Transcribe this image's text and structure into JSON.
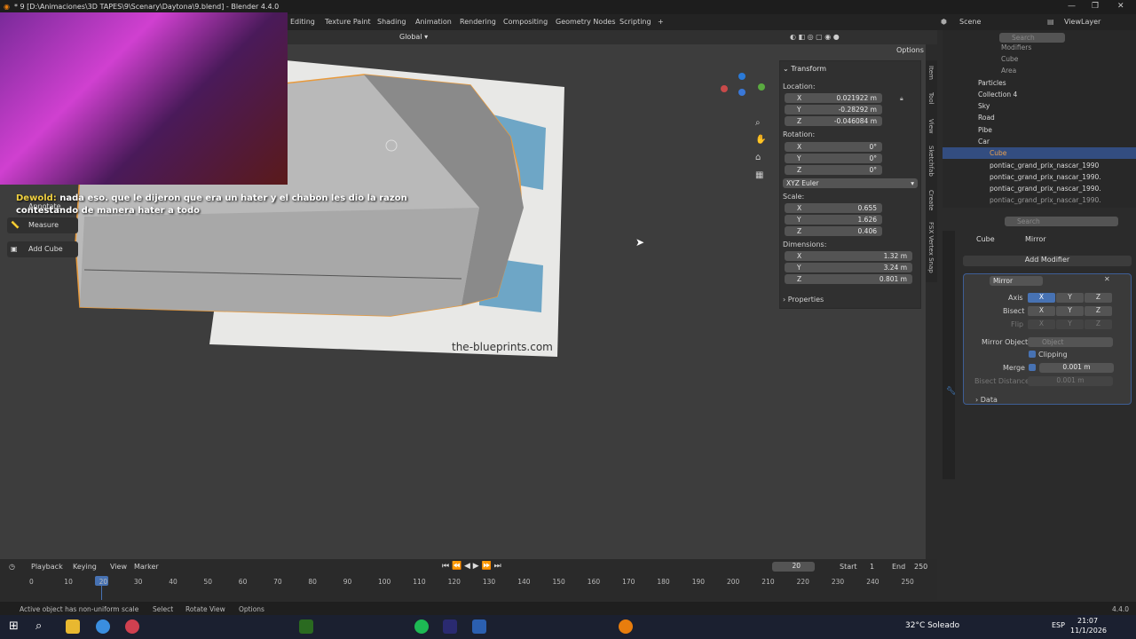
{
  "window": {
    "title": "* 9 [D:\\Animaciones\\3D TAPES\\9\\Scenary\\Daytona\\9.blend] - Blender 4.4.0"
  },
  "menu_tabs": [
    "Editing",
    "Texture Paint",
    "Shading",
    "Animation",
    "Rendering",
    "Compositing",
    "Geometry Nodes",
    "Scripting",
    "+"
  ],
  "top_right": {
    "scene": "Scene",
    "view_layer": "ViewLayer"
  },
  "viewport_header": {
    "orientation": "Global",
    "options": "Options"
  },
  "chat": {
    "user": "Dewold:",
    "line1": " nada eso. que le dijeron que era un hater y el chabon les dio la razon",
    "line2": "contestando de manera hater a todo"
  },
  "tools": {
    "annotate": "Annotate",
    "measure": "Measure",
    "add_cube": "Add Cube"
  },
  "blueprint": {
    "site": "the-blueprints.com"
  },
  "npanel": {
    "section": "Transform",
    "location_label": "Location:",
    "location": [
      {
        "axis": "X",
        "value": "0.021922 m"
      },
      {
        "axis": "Y",
        "value": "-0.28292 m"
      },
      {
        "axis": "Z",
        "value": "-0.046084 m"
      }
    ],
    "rotation_label": "Rotation:",
    "rotation": [
      {
        "axis": "X",
        "value": "0°"
      },
      {
        "axis": "Y",
        "value": "0°"
      },
      {
        "axis": "Z",
        "value": "0°"
      }
    ],
    "rotation_mode": "XYZ Euler",
    "scale_label": "Scale:",
    "scale": [
      {
        "axis": "X",
        "value": "0.655"
      },
      {
        "axis": "Y",
        "value": "1.626"
      },
      {
        "axis": "Z",
        "value": "0.406"
      }
    ],
    "dimensions_label": "Dimensions:",
    "dimensions": [
      {
        "axis": "X",
        "value": "1.32 m"
      },
      {
        "axis": "Y",
        "value": "3.24 m"
      },
      {
        "axis": "Z",
        "value": "0.801 m"
      }
    ],
    "properties": "Properties"
  },
  "side_tabs": [
    "Item",
    "Tool",
    "View",
    "Sketchfab",
    "Create",
    "FSX Vertex Snap"
  ],
  "outliner": {
    "search_placeholder": "Search",
    "rows": [
      "Modifiers",
      "Cube",
      "Area",
      "Particles",
      "Collection 4",
      "Sky",
      "Road",
      "Pibe",
      "Car",
      "Cube",
      "pontiac_grand_prix_nascar_1990",
      "pontiac_grand_prix_nascar_1990.",
      "pontiac_grand_prix_nascar_1990.",
      "pontiac_grand_prix_nascar_1990."
    ]
  },
  "properties": {
    "search_placeholder": "Search",
    "breadcrumb_object": "Cube",
    "breadcrumb_modifier": "Mirror",
    "add_modifier": "Add Modifier",
    "modifier_name": "Mirror",
    "axis_label": "Axis",
    "bisect_label": "Bisect",
    "flip_label": "Flip",
    "axes": [
      "X",
      "Y",
      "Z"
    ],
    "mirror_object_label": "Mirror Object",
    "mirror_object_placeholder": "Object",
    "clipping": "Clipping",
    "merge_label": "Merge",
    "merge_value": "0.001 m",
    "bisect_distance_label": "Bisect Distance",
    "bisect_distance_value": "0.001 m",
    "data": "Data"
  },
  "timeline": {
    "playback": "Playback",
    "keying": "Keying",
    "view": "View",
    "marker": "Marker",
    "current_frame": "20",
    "start_label": "Start",
    "start": "1",
    "end_label": "End",
    "end": "250",
    "ticks": [
      "0",
      "10",
      "20",
      "30",
      "40",
      "50",
      "60",
      "70",
      "80",
      "90",
      "100",
      "110",
      "120",
      "130",
      "140",
      "150",
      "160",
      "170",
      "180",
      "190",
      "200",
      "210",
      "220",
      "230",
      "240",
      "250"
    ]
  },
  "status": {
    "msg": "Active object has non-uniform scale",
    "select": "Select",
    "rotate_view": "Rotate View",
    "options": "Options",
    "version": "4.4.0"
  },
  "taskbar": {
    "weather": "32°C  Soleado",
    "lang": "ESP",
    "time": "21:07",
    "date": "11/1/2026"
  },
  "colors": {
    "accent": "#4772b3",
    "selection_outline": "#e89a3c"
  }
}
